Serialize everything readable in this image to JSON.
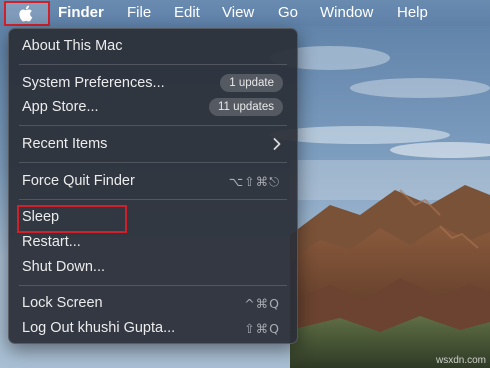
{
  "menubar": {
    "apple_icon": "apple-logo-icon",
    "app_name": "Finder",
    "menus": [
      "File",
      "Edit",
      "View",
      "Go",
      "Window",
      "Help"
    ]
  },
  "apple_menu": {
    "about": "About This Mac",
    "system_preferences": {
      "label": "System Preferences...",
      "badge": "1 update"
    },
    "app_store": {
      "label": "App Store...",
      "badge": "11 updates"
    },
    "recent_items": {
      "label": "Recent Items",
      "icon": "chevron-right-icon"
    },
    "force_quit": {
      "label": "Force Quit Finder",
      "shortcut": "⌥⇧⌘⎋"
    },
    "sleep": "Sleep",
    "restart": "Restart...",
    "shut_down": "Shut Down...",
    "lock_screen": {
      "label": "Lock Screen",
      "shortcut": "^⌘Q"
    },
    "log_out": {
      "label": "Log Out khushi Gupta...",
      "shortcut": "⇧⌘Q"
    }
  },
  "annotations": {
    "highlight_color": "#d0212b"
  },
  "watermark": "wsxdn.com"
}
